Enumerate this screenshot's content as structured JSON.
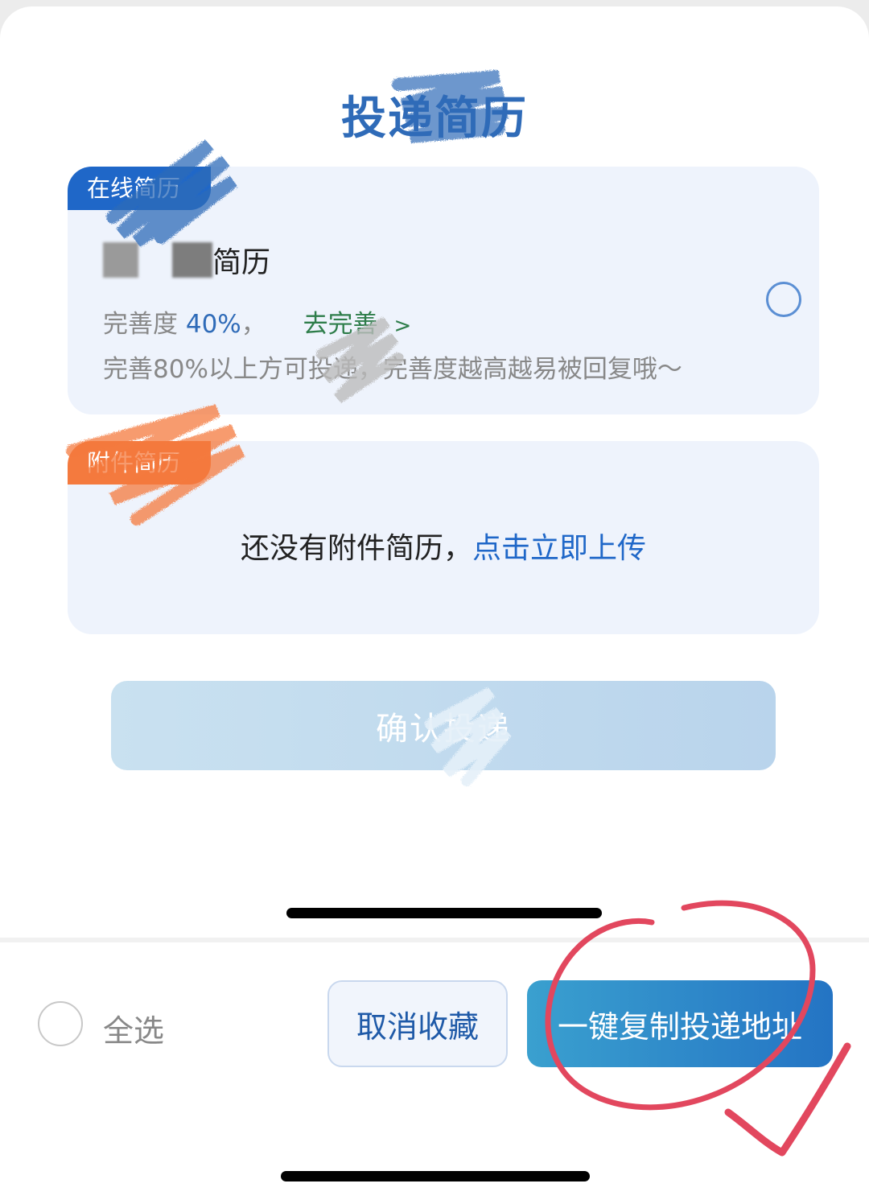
{
  "dialog": {
    "title": "投递简历"
  },
  "online_resume": {
    "tag": "在线简历",
    "name_suffix": "简历",
    "completion_label": "完善度",
    "completion_value": "40%",
    "completion_comma": "，",
    "improve_link": "去完善",
    "improve_chevron": ">",
    "hint": "完善80%以上方可投递，完善度越高越易被回复哦～"
  },
  "attachment_resume": {
    "tag": "附件简历",
    "empty_text": "还没有附件简历，",
    "upload_link": "点击立即上传"
  },
  "confirm_button": "确认投递",
  "bottom_bar": {
    "select_all": "全选",
    "cancel_favorite": "取消收藏",
    "copy_address": "一键复制投递地址"
  },
  "colors": {
    "accent_blue": "#1f67c8",
    "orange_tag": "#f47a3e",
    "green_link": "#2e7d4a",
    "annotation_red": "#e2475e"
  },
  "icons": [
    "radio-unchecked-icon",
    "chevron-right-icon"
  ]
}
